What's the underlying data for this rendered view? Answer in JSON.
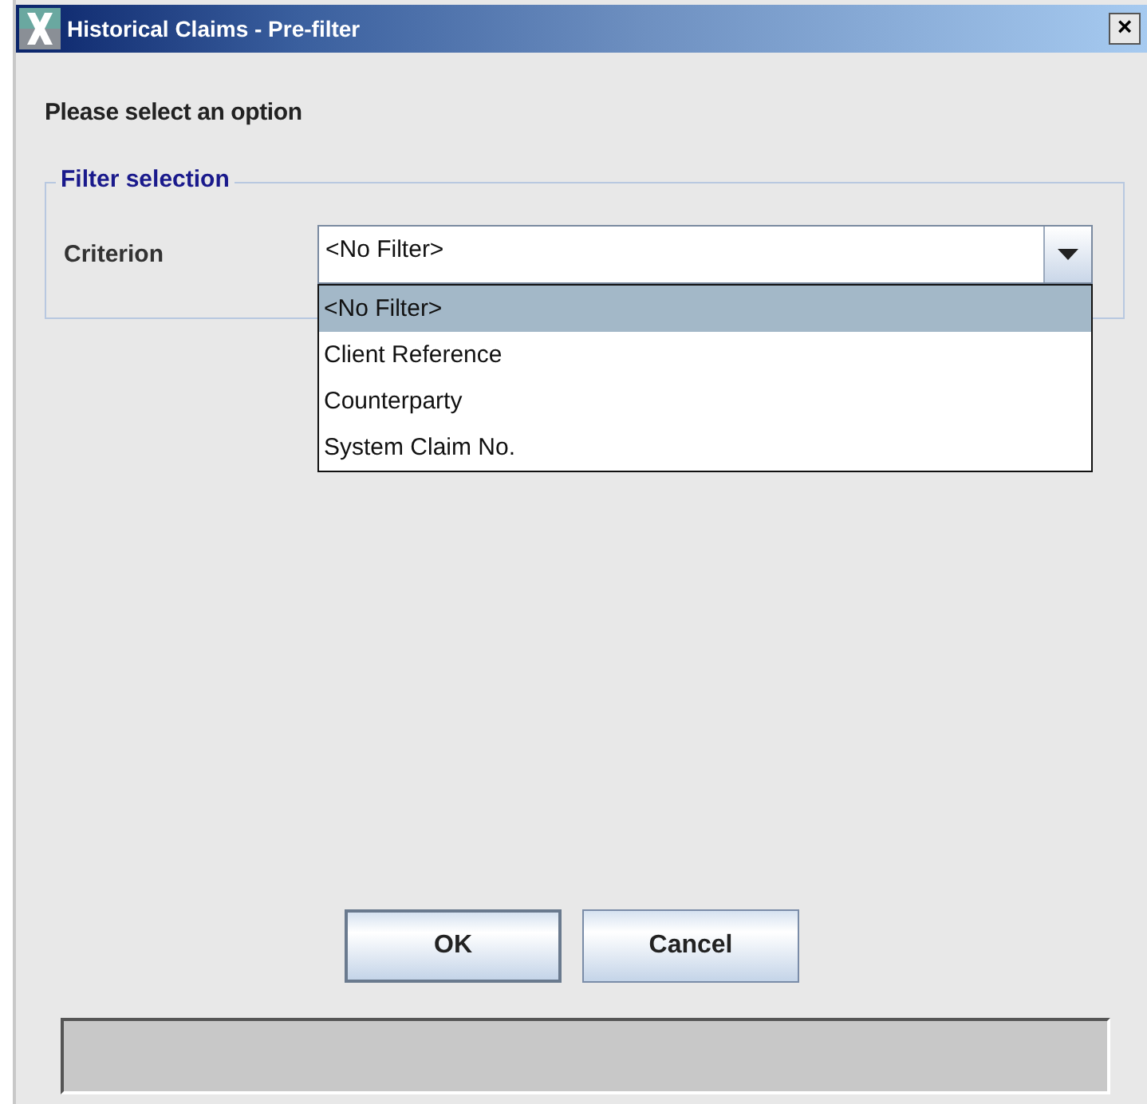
{
  "window": {
    "title": "Historical Claims - Pre-filter",
    "close": "×"
  },
  "prompt": "Please select an option",
  "filter_group": {
    "title": "Filter selection",
    "label": "Criterion",
    "value": "<No Filter>",
    "expanded": true,
    "options": [
      {
        "label": "<No Filter>",
        "selected": true
      },
      {
        "label": "Client Reference",
        "selected": false
      },
      {
        "label": "Counterparty",
        "selected": false
      },
      {
        "label": "System Claim No.",
        "selected": false
      }
    ]
  },
  "buttons": [
    {
      "label": "OK",
      "default": true
    },
    {
      "label": "Cancel",
      "default": false
    }
  ]
}
